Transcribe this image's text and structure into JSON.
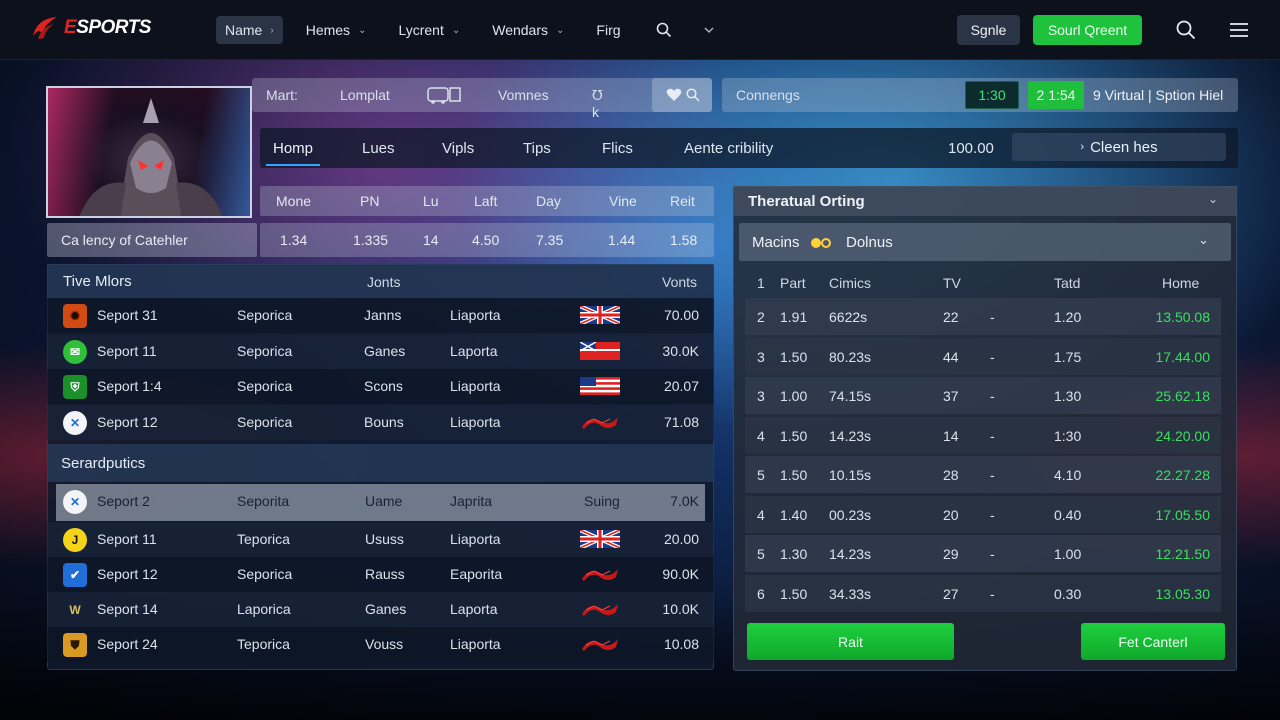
{
  "brand": {
    "name_a": "E",
    "name_b": "SPORTS"
  },
  "nav": {
    "items": [
      {
        "label": "Name",
        "chev": "›"
      },
      {
        "label": "Hemes",
        "chev": "⌄"
      },
      {
        "label": "Lycrent",
        "chev": "⌄"
      },
      {
        "label": "Wendars",
        "chev": "⌄"
      },
      {
        "label": "Firg",
        "chev": ""
      }
    ],
    "sign_label": "Sgnle",
    "signup_label": "Sourl Qreent"
  },
  "filterbar": {
    "label1": "Mart:",
    "label2": "Lomplat",
    "label3": "Vomnes",
    "label4": "℧ k",
    "label5": "Connengs",
    "time1": "1:30",
    "time2": "2 1:54",
    "virtual": "9 Virtual | Sption Hiel"
  },
  "tabs": {
    "items": [
      "Homp",
      "Lues",
      "Vipls",
      "Tips",
      "Flics",
      "Aente cribility"
    ],
    "value": "100.00",
    "clean_label": "Cleen hes"
  },
  "summary": {
    "headers": [
      "Mone",
      "PN",
      "Lu",
      "Laft",
      "Day",
      "Vine",
      "Reit"
    ],
    "label": "Ca lency of Catehler",
    "values": [
      "1.34",
      "1.335",
      "14",
      "4.50",
      "7.35",
      "1.44",
      "1.58"
    ]
  },
  "live": {
    "title": "Tive Mlors",
    "col1": "Jonts",
    "col2": "Vonts",
    "rows": [
      {
        "name": "Seport 31",
        "a": "Seporica",
        "b": "Janns",
        "c": "Liaporta",
        "val": "70.00",
        "icon": "red",
        "flag": "uk"
      },
      {
        "name": "Seport 11",
        "a": "Seporica",
        "b": "Ganes",
        "c": "Laporta",
        "val": "30.0K",
        "icon": "green",
        "flag": "mix"
      },
      {
        "name": "Seport 1:4",
        "a": "Seporica",
        "b": "Scons",
        "c": "Liaporta",
        "val": "20.07",
        "icon": "dgreen",
        "flag": "us"
      },
      {
        "name": "Seport 12",
        "a": "Seporica",
        "b": "Bouns",
        "c": "Liaporta",
        "val": "71.08",
        "icon": "white",
        "flag": "red"
      }
    ]
  },
  "sep": {
    "title": "Serardputics",
    "rows": [
      {
        "name": "Seport 2",
        "a": "Seporita",
        "b": "Uame",
        "c": "Japrita",
        "d": "Suing",
        "val": "7.0K",
        "icon": "white",
        "flag": "",
        "hl": true
      },
      {
        "name": "Seport 11",
        "a": "Teporica",
        "b": "Ususs",
        "c": "Liaporta",
        "d": "",
        "val": "20.00",
        "icon": "yellow",
        "flag": "uk",
        "hl": false
      },
      {
        "name": "Seport 12",
        "a": "Seporica",
        "b": "Rauss",
        "c": "Eaporita",
        "d": "",
        "val": "90.0K",
        "icon": "blue",
        "flag": "red",
        "hl": false
      },
      {
        "name": "Seport 14",
        "a": "Laporica",
        "b": "Ganes",
        "c": "Laporta",
        "d": "",
        "val": "10.0K",
        "icon": "gold",
        "flag": "red",
        "hl": false
      },
      {
        "name": "Seport 24",
        "a": "Teporica",
        "b": "Vouss",
        "c": "Liaporta",
        "d": "",
        "val": "10.08",
        "icon": "orange",
        "flag": "red",
        "hl": false
      }
    ]
  },
  "right": {
    "title": "Theratual Orting",
    "sub1": "Macins",
    "sub2": "Dolnus",
    "headers": [
      "1",
      "Part",
      "Cimics",
      "TV",
      "Tatd",
      "Home"
    ],
    "rows": [
      [
        "2",
        "1.91",
        "6622s",
        "22",
        "-",
        "1.20",
        "13.50.08"
      ],
      [
        "3",
        "1.50",
        "80.23s",
        "44",
        "-",
        "1.75",
        "17.44.00"
      ],
      [
        "3",
        "1.00",
        "74.15s",
        "37",
        "-",
        "1.30",
        "25.62.18"
      ],
      [
        "4",
        "1.50",
        "14.23s",
        "14",
        "-",
        "1:30",
        "24.20.00"
      ],
      [
        "5",
        "1.50",
        "10.15s",
        "28",
        "-",
        "4.10",
        "22.27.28"
      ],
      [
        "4",
        "1.40",
        "00.23s",
        "20",
        "-",
        "0.40",
        "17.05.50"
      ],
      [
        "5",
        "1.30",
        "14.23s",
        "29",
        "-",
        "1.00",
        "12.21.50"
      ],
      [
        "6",
        "1.50",
        "34.33s",
        "27",
        "-",
        "0.30",
        "13.05.30"
      ]
    ],
    "btn_left": "Rait",
    "btn_right": "Fet Canterl"
  },
  "colors": {
    "accent_green": "#1fcf3f",
    "brand_red": "#e02424"
  }
}
